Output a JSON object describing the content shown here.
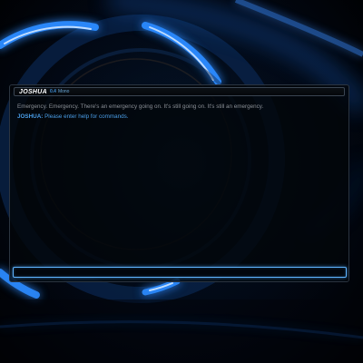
{
  "window": {
    "app_name": "JOSHUA",
    "version": "0.4",
    "font_label": "Mono"
  },
  "output": {
    "emergency_line": "Emergency. Emergency. There's an emergency going on. It's still going on. It's still an emergency.",
    "prompt_speaker": "JOSHUA:",
    "prompt_text": " Please enter help for commands."
  },
  "input": {
    "value": "",
    "placeholder": ""
  },
  "colors": {
    "accent_blue": "#4a9ee8",
    "input_glow": "#5fb4ff",
    "wallpaper_ring": "#1e7bff",
    "text_gray": "#8a8f96"
  },
  "icons": {
    "wallpaper": "glowing-blue-rings-wallpaper"
  }
}
